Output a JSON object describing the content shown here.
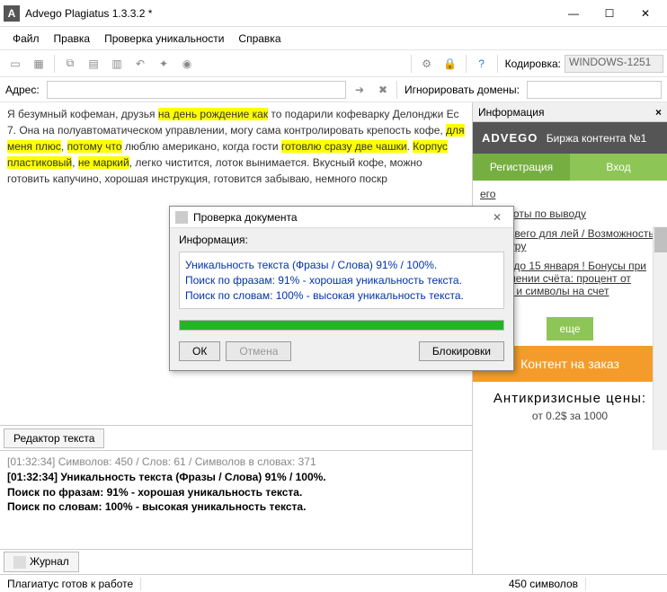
{
  "window": {
    "icon_letter": "A",
    "title": "Advego Plagiatus 1.3.3.2 *"
  },
  "menu": {
    "file": "Файл",
    "edit": "Правка",
    "check": "Проверка уникальности",
    "help": "Справка"
  },
  "toolbar": {
    "encoding_label": "Кодировка:",
    "encoding_value": "WINDOWS-1251"
  },
  "addressbar": {
    "label": "Адрес:",
    "value": "",
    "ignore_label": "Игнорировать домены:",
    "ignore_value": ""
  },
  "editor": {
    "tab": "Редактор текста",
    "text_parts": [
      {
        "t": "Я безумный кофеман, друзья ",
        "h": false
      },
      {
        "t": "на день рождение как",
        "h": true
      },
      {
        "t": " то подарили кофеварку Делонджи Ес 7. Она на полуавтоматическом управлении, могу сама контролировать крепость кофе, ",
        "h": false
      },
      {
        "t": "для меня плюс",
        "h": true
      },
      {
        "t": ", ",
        "h": false
      },
      {
        "t": "потому что",
        "h": true
      },
      {
        "t": " люблю американо, когда гости ",
        "h": false
      },
      {
        "t": "готовлю сразу две чашки",
        "h": true
      },
      {
        "t": ". ",
        "h": false
      },
      {
        "t": "Корпус пластиковый",
        "h": true
      },
      {
        "t": ", ",
        "h": false
      },
      {
        "t": "не маркий",
        "h": true
      },
      {
        "t": ", легко чистится, лоток вынимается. Вкусный кофе, можно готовить капучино, хорошая инструкция, готовится",
        "h": false
      },
      {
        "t": "\nзабываю, немного поскр",
        "h": false
      }
    ]
  },
  "log": {
    "tab": "Журнал",
    "lines": [
      {
        "cls": "gray",
        "text": "[01:32:34] Символов: 450 / Слов: 61 / Символов в словах: 371"
      },
      {
        "cls": "bold",
        "text": "[01:32:34] Уникальность текста (Фразы / Слова) 91% / 100%."
      },
      {
        "cls": "bold",
        "text": "Поиск по фразам: 91% - хорошая уникальность текста."
      },
      {
        "cls": "bold",
        "text": "Поиск по словам: 100% - высокая уникальность текста."
      }
    ]
  },
  "side": {
    "header": "Информация",
    "brand_name": "ADVEGO",
    "brand_sub": "Биржа контента №1",
    "register": "Регистрация",
    "login": "Вход",
    "news": [
      "его",
      "ие работы по выводу",
      "ция Адвего для\nлей / Возможность\nатус Гуру",
      "длена до 15 января\n! Бонусы при пополнении счёта: процент от суммы и символы на счет"
    ],
    "more": "еще",
    "order_title": "Контент на заказ",
    "prices_title": "Антикризисные  цены:",
    "prices_line": "от 0.2$  за 1000"
  },
  "status": {
    "ready": "Плагиатус готов к работе",
    "chars": "450 символов"
  },
  "dialog": {
    "title": "Проверка документа",
    "label": "Информация:",
    "lines": [
      "Уникальность текста (Фразы / Слова) 91% / 100%.",
      "Поиск по фразам: 91% - хорошая уникальность текста.",
      "Поиск по словам: 100% - высокая уникальность текста."
    ],
    "ok": "ОК",
    "cancel": "Отмена",
    "block": "Блокировки"
  }
}
